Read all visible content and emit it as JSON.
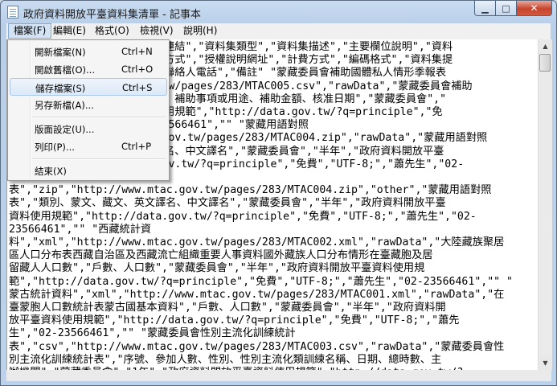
{
  "window": {
    "title": "政府資料開放平臺資料集清單 - 記事本",
    "minimize_glyph": "▁",
    "maximize_glyph": "□",
    "close_glyph": "✕"
  },
  "menubar": {
    "items": [
      "檔案(F)",
      "編輯(E)",
      "格式(O)",
      "檢視(V)",
      "說明(H)"
    ]
  },
  "file_menu": {
    "items": [
      {
        "label": "開新檔案(N)",
        "shortcut": "Ctrl+N"
      },
      {
        "label": "開啟舊檔(O)...",
        "shortcut": "Ctrl+O"
      },
      {
        "label": "儲存檔案(S)",
        "shortcut": "Ctrl+S"
      },
      {
        "label": "另存新檔(A)...",
        "shortcut": ""
      },
      {
        "label": "版面設定(U)...",
        "shortcut": ""
      },
      {
        "label": "列印(P)...",
        "shortcut": "Ctrl+P"
      },
      {
        "label": "結束(X)",
        "shortcut": ""
      }
    ],
    "highlighted": "儲存檔案(S)"
  },
  "document": {
    "lines": [
      "                     下載連結\",\"資料集類型\",\"資料集描述\",\"主要欄位說明\",\"資料",
      "                     授權方式\",\"授權說明網址\",\"計費方式\",\"編碼格式\",\"資料集提",
      "                     機關聯絡人電話\",\"備註\" \"蒙藏委員會補助國體私人情形季報表",
      "                    gov.tw/pages/283/MTAC005.csv\",\"rawData\",\"蒙藏委員會補助",
      "                     對象、補助事項或用途、補助金額、核准日期\",\"蒙藏委員會\",\"",
      "                     料使用規範\",\"http://data.gov.tw/?q=principle\",\"免",
      "                     2-23566461\",\"\" \"蒙藏用語對照",
      "                     tc.gov.tw/pages/283/MTAC004.zip\",\"rawData\",\"蒙藏用語對照",
      "                     文譯名、中文譯名\",\"蒙藏委員會\",\"半年\",\"政府資料開放平臺",
      "                     a.gov.tw/?q=principle\",\"免費\",\"UTF-8;\",\"蕭先生\",\"02-",
      "",
      "表\",\"zip\",\"http://www.mtac.gov.tw/pages/283/MTAC004.zip\",\"other\",\"蒙藏用語對照",
      "表\",\"類別、蒙文、藏文、英文譯名、中文譯名\",\"蒙藏委員會\",\"半年\",\"政府資料開放平臺",
      "資料使用規範\",\"http://data.gov.tw/?q=principle\",\"免費\",\"UTF-8;\",\"蕭先生\",\"02-",
      "23566461\",\"\" \"西藏統計資",
      "料\",\"xml\",\"http://www.mtac.gov.tw/pages/283/MTAC002.xml\",\"rawData\",\"大陸藏族聚居",
      "區人口分布表西藏自治區及西藏流亡組織重要人事資料國外藏族人口分布情形在臺藏胞及居",
      "留藏人人口數\",\"戶數、人口數\",\"蒙藏委員會\",\"半年\",\"政府資料開放平臺資料使用規",
      "範\",\"http://data.gov.tw/?q=principle\",\"免費\",\"UTF-8;\",\"蕭先生\",\"02-23566461\",\"\" \"",
      "蒙古統計資料\",\"xml\",\"http://www.mtac.gov.tw/pages/283/MTAC001.xml\",\"rawData\",\"在",
      "臺蒙胞人口數統計表蒙古國基本資料\",\"戶數、人口數\",\"蒙藏委員會\",\"半年\",\"政府資料開",
      "放平臺資料使用規範\",\"http://data.gov.tw/?q=principle\",\"免費\",\"UTF-8;\",\"蕭先",
      "生\",\"02-23566461\",\"\" \"蒙藏委員會性別主流化訓練統計",
      "表\",\"csv\",\"http://www.mtac.gov.tw/pages/283/MTAC003.csv\",\"rawData\",\"蒙藏委員會性",
      "別主流化訓練統計表\",\"序號、參加人數、性別、性別主流化類訓練名稱、日期、總時數、主",
      "辦機關\",\"蒙藏委員會\",\"1年\",\"政府資料開放平臺資料使用規範\",\"http://data.gov.tw/?"
    ]
  },
  "icons": {
    "app": "notepad-icon",
    "scroll_up": "arrow-up-icon",
    "scroll_down": "arrow-down-icon"
  },
  "colors": {
    "frame": "#bcd2ea",
    "close_button": "#c6442d",
    "menu_highlight": "#dce9f7"
  }
}
